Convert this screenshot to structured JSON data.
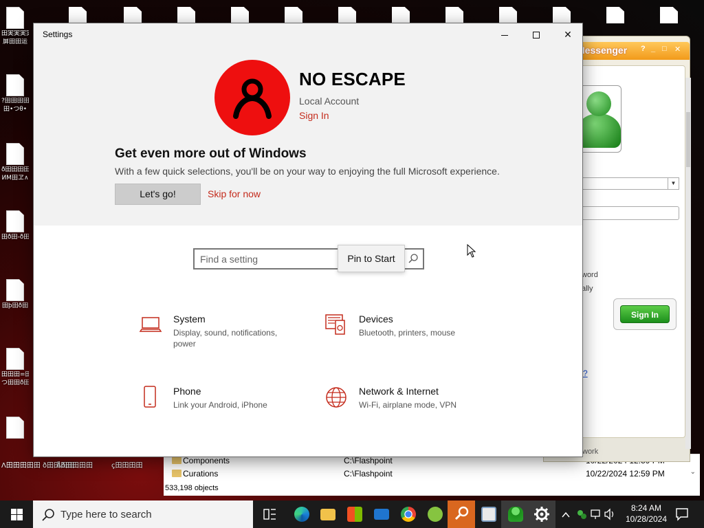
{
  "desktop": {
    "side_icons": [
      {
        "label": "田実実実実",
        "label2": "屏田田运"
      },
      {
        "label": "?田田田田",
        "label2": "田•つθ•"
      },
      {
        "label": "ð田田田田",
        "label2": "ЙМ田ヱ∧"
      },
      {
        "label": "田ð田-ð田",
        "label2": ""
      },
      {
        "label": "田þ田ð田",
        "label2": ""
      },
      {
        "label": "田田田=田田",
        "label2": "つ田田ð田"
      }
    ],
    "bottom_labels": [
      "Λ田田田田田 ð田田田田",
      "Äð田田田田",
      "ç田田田田"
    ]
  },
  "explorer": {
    "rows": [
      {
        "name": "Components",
        "path": "C:\\Flashpoint",
        "date": "10/22/2024 12:59 PM"
      },
      {
        "name": "Curations",
        "path": "C:\\Flashpoint",
        "date": "10/22/2024 12:59 PM"
      }
    ],
    "status": "533,198 objects"
  },
  "messenger": {
    "title": "Messenger",
    "ctl_help": "?",
    "ctl_min": "_",
    "ctl_max": "□",
    "ctl_close": "✕",
    "remember_password": "word",
    "sign_in_auto": "ally",
    "signin_label": "Sign In",
    "link_fragment": "?",
    "footer": "work"
  },
  "settings": {
    "window_title": "Settings",
    "account": {
      "name": "NO ESCAPE",
      "type": "Local Account",
      "signin_link": "Sign In",
      "avatar_color": "#ee0f0f"
    },
    "promo": {
      "title": "Get even more out of Windows",
      "text": "With a few quick selections, you'll be on your way to enjoying the full Microsoft experience.",
      "primary_button": "Let's go!",
      "secondary_link": "Skip for now"
    },
    "search": {
      "placeholder": "Find a setting",
      "tooltip": "Pin to Start"
    },
    "categories": [
      {
        "name": "System",
        "desc": "Display, sound, notifications, power",
        "icon": "laptop-icon"
      },
      {
        "name": "Devices",
        "desc": "Bluetooth, printers, mouse",
        "icon": "devices-icon"
      },
      {
        "name": "Phone",
        "desc": "Link your Android, iPhone",
        "icon": "phone-icon"
      },
      {
        "name": "Network & Internet",
        "desc": "Wi-Fi, airplane mode, VPN",
        "icon": "globe-icon"
      }
    ],
    "accent_color": "#c42b1c"
  },
  "taskbar": {
    "search_text": "Type here to search",
    "clock_time": "8:24 AM",
    "clock_date": "10/28/2024"
  }
}
